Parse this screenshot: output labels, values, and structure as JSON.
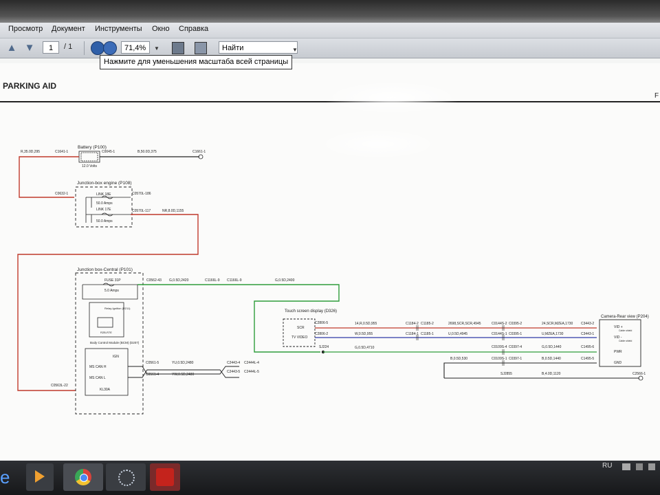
{
  "menu": [
    "Просмотр",
    "Документ",
    "Инструменты",
    "Окно",
    "Справка"
  ],
  "toolbar": {
    "page_current": "1",
    "page_total": "/ 1",
    "zoom": "71,4%",
    "search_placeholder": "Найти"
  },
  "tooltip": "Нажмите для уменьшения масштаба всей страницы",
  "document": {
    "title": "PARKING AID",
    "page_mark": "F"
  },
  "schematic": {
    "battery": {
      "title": "Battery (P100)",
      "voltage": "12.0 Volts",
      "wire_left": "R,35.0D,295",
      "conn_left": "C1641-1",
      "conn_right": "C0045-1",
      "wire_right": "B,50.0D,375",
      "ground": "C1661-1"
    },
    "junction_engine": {
      "title": "Junction-box engine (P108)",
      "conn_in": "C0632-1",
      "link1": "LINK 18E",
      "link1_amps": "50.0 Amps",
      "link1_conn": "C0570L-186",
      "link2": "LINK 17E",
      "link2_amps": "50.0 Amps",
      "link2_conn": "C0570L-117",
      "wire_out": "NR,8.0D,1155"
    },
    "junction_central": {
      "title": "Junction box-Central (P101)",
      "fuse": "FUSE 31P",
      "fuse_amps": "5.0 Amps",
      "relay": "Relay-Ignition (R211)",
      "relay_ref": "R2B-R7E",
      "bcm": "Body Control Module (BCM) (D207)",
      "ign": "IGN",
      "ms_can_h": "MS CAN H",
      "ms_can_l": "MS CAN L",
      "kl30a": "KL30A",
      "conn_in": "C0563L-22"
    },
    "wiring": {
      "fuse_conn": "C0562-43",
      "fuse_wire": "G,0.5D,2420",
      "inline1": "C1166L-9",
      "inline2": "C1166L-9",
      "green_wire": "G,0.5D,2400",
      "canh_conn": "C0561-5",
      "canh_wire": "YU,0.5D,2480",
      "canh_out": "C2443-4",
      "canh_out2": "C2444L-4",
      "canl_conn": "C0561-4",
      "canl_wire": "YW,0.5D,2480",
      "canl_out": "C2443-5",
      "canl_out2": "C2444L-5"
    },
    "display": {
      "title": "Touch screen display (D326)",
      "scr": "SCR",
      "tv_video": "TV VIDEO",
      "conn_scr": "C2806-5",
      "conn_tv": "C2806-2",
      "splice": "SJ224"
    },
    "cables": {
      "scr_wire": "14,R,0.5D,955",
      "scr_c1": "C1184-2",
      "scr_c2": "C1185-2",
      "scr_shield": "2698,SCR,SCR,4945",
      "scr_c3": "C0144S-2",
      "scr_c4": "C0395-2",
      "scr_wire2": "24,SCR,MZEA,1730",
      "scr_end": "C3443-2",
      "tv_wire": "W,0.5D,955",
      "tv_c1": "C1184-1",
      "tv_c2": "C1185-1",
      "tv_wire_mid": "U,0.5D,4945",
      "tv_c3": "C0144S-1",
      "tv_c4": "C0395-1",
      "tv_wire2": "U,MZEA,1730",
      "tv_end": "C3443-1",
      "pwr_wire": "G,0.5D,4710",
      "pwr_c1": "C0109S-4",
      "pwr_c2": "C0397-4",
      "pwr_wire2": "G,0.5D,1440",
      "pwr_end": "C1495-6",
      "gnd_wire": "B,0.5D,530",
      "gnd_c1": "C0109S-1",
      "gnd_c2": "C0397-1",
      "gnd_wire2": "B,0.5D,1440",
      "gnd_end": "C1495-5",
      "gnd_splice": "SJ2855",
      "gnd_wire3": "B,4.0D,1120",
      "gnd_ground": "C2566-1"
    },
    "camera": {
      "title": "Camera-Rear view (P204)",
      "vid_plus": "VID +",
      "vid_minus": "VID -",
      "pwr": "PWR",
      "gnd": "GND",
      "shield": "Cable shield"
    }
  },
  "taskbar": {
    "lang": "RU"
  }
}
